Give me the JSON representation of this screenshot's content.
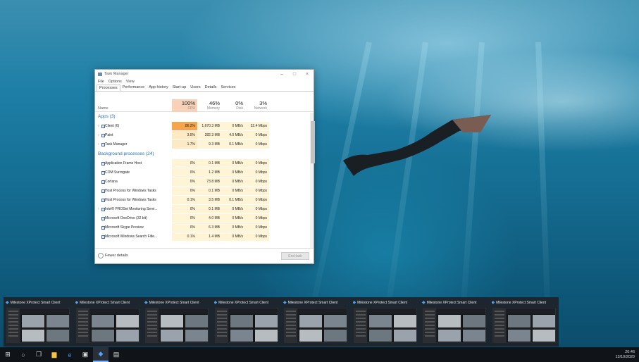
{
  "task_manager": {
    "title": "Task Manager",
    "menu": [
      "File",
      "Options",
      "View"
    ],
    "tabs": [
      "Processes",
      "Performance",
      "App history",
      "Start-up",
      "Users",
      "Details",
      "Services"
    ],
    "active_tab": "Processes",
    "columns": {
      "name": "Name",
      "cpu": {
        "pct": "100%",
        "label": "CPU"
      },
      "memory": {
        "pct": "46%",
        "label": "Memory"
      },
      "disk": {
        "pct": "0%",
        "label": "Disk"
      },
      "network": {
        "pct": "3%",
        "label": "Network"
      }
    },
    "apps_group": "Apps (3)",
    "apps": [
      {
        "name": "Client (6)",
        "cpu": "86.2%",
        "mem": "1,670.3 MB",
        "disk": "0 MB/s",
        "net": "32.4 Mbps"
      },
      {
        "name": "Paint",
        "cpu": "3.5%",
        "mem": "282.3 MB",
        "disk": "4.0 MB/s",
        "net": "0 Mbps"
      },
      {
        "name": "Task Manager",
        "cpu": "1.7%",
        "mem": "9.3 MB",
        "disk": "0.1 MB/s",
        "net": "0 Mbps"
      }
    ],
    "bg_group": "Background processes (24)",
    "background": [
      {
        "name": "Application Frame Host",
        "cpu": "0%",
        "mem": "0.1 MB",
        "disk": "0 MB/s",
        "net": "0 Mbps"
      },
      {
        "name": "COM Surrogate",
        "cpu": "0%",
        "mem": "1.2 MB",
        "disk": "0 MB/s",
        "net": "0 Mbps"
      },
      {
        "name": "Cortana",
        "cpu": "0%",
        "mem": "73.8 MB",
        "disk": "0 MB/s",
        "net": "0 Mbps"
      },
      {
        "name": "Host Process for Windows Tasks",
        "cpu": "0%",
        "mem": "0.1 MB",
        "disk": "0 MB/s",
        "net": "0 Mbps"
      },
      {
        "name": "Host Process for Windows Tasks",
        "cpu": "0.1%",
        "mem": "3.5 MB",
        "disk": "0.1 MB/s",
        "net": "0 Mbps"
      },
      {
        "name": "Intel® PROSet Monitoring Servi...",
        "cpu": "0%",
        "mem": "0.1 MB",
        "disk": "0 MB/s",
        "net": "0 Mbps"
      },
      {
        "name": "Microsoft OneDrive (32 bit)",
        "cpu": "0%",
        "mem": "4.0 MB",
        "disk": "0 MB/s",
        "net": "0 Mbps"
      },
      {
        "name": "Microsoft Skype Preview",
        "cpu": "0%",
        "mem": "6.3 MB",
        "disk": "0 MB/s",
        "net": "0 Mbps"
      },
      {
        "name": "Microsoft Windows Search Filte...",
        "cpu": "0.1%",
        "mem": "1.4 MB",
        "disk": "0 MB/s",
        "net": "0 Mbps"
      }
    ],
    "fewer_details": "Fewer details",
    "end_task": "End task"
  },
  "thumbnails": [
    {
      "title": "Milestone XProtect Smart Client"
    },
    {
      "title": "Milestone XProtect Smart Client"
    },
    {
      "title": "Milestone XProtect Smart Client"
    },
    {
      "title": "Milestone XProtect Smart Client"
    },
    {
      "title": "Milestone XProtect Smart Client"
    },
    {
      "title": "Milestone XProtect Smart Client"
    },
    {
      "title": "Milestone XProtect Smart Client"
    },
    {
      "title": "Milestone XProtect Smart Client"
    }
  ],
  "taskbar": {
    "icons": [
      "windows-start-icon",
      "cortana-icon",
      "task-view-icon",
      "file-explorer-icon",
      "edge-icon",
      "store-icon",
      "xprotect-icon",
      "task-manager-icon"
    ],
    "time": "20:46",
    "date": "13/10/2020"
  },
  "colors": {
    "cpu_hot": "#f5a64c",
    "cpu_warm": "#fde9c3",
    "cpu_cool": "#fff4d6",
    "accent": "#2a6ebb",
    "taskbar": "#101418"
  }
}
